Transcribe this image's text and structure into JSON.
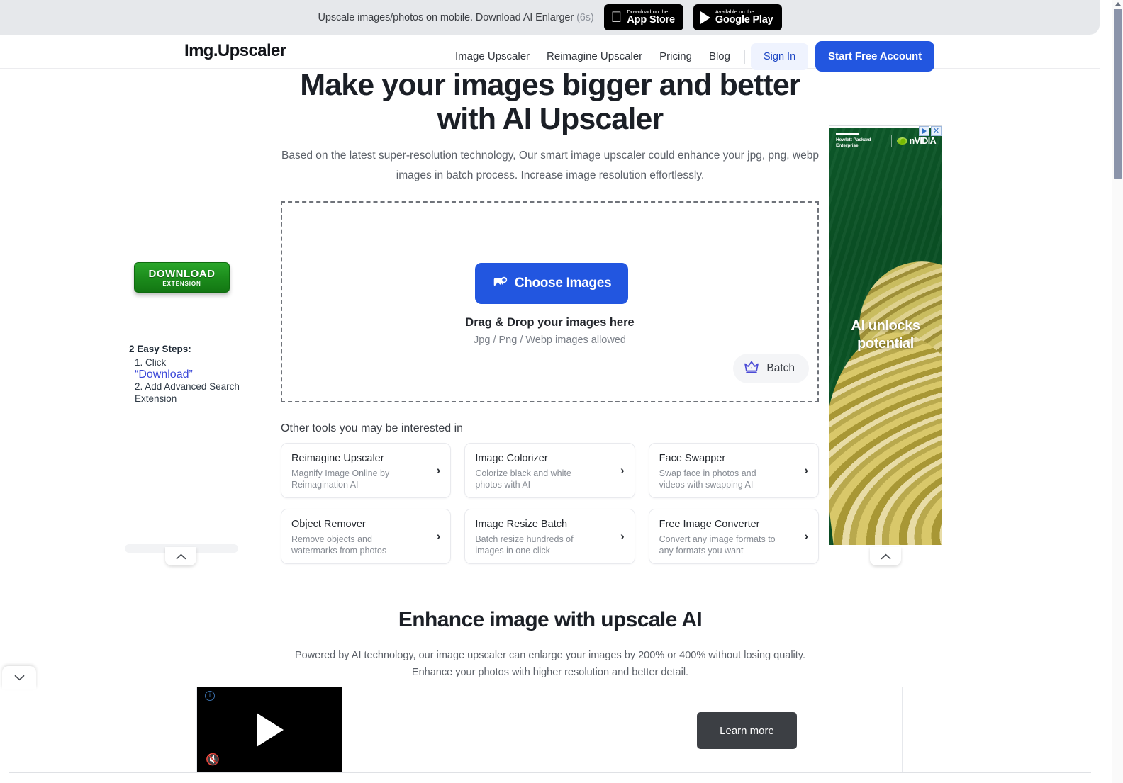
{
  "promo": {
    "text": "Upscale images/photos on mobile. Download AI Enlarger",
    "countdown": "(6s)",
    "appstore": {
      "small": "Download on the",
      "big": "App Store",
      "icon": "apple-icon"
    },
    "googleplay": {
      "small": "Available on the",
      "big": "Google Play",
      "icon": "google-play-icon"
    }
  },
  "header": {
    "logo": "Img.Upscaler",
    "nav": [
      {
        "label": "Image Upscaler"
      },
      {
        "label": "Reimagine Upscaler"
      },
      {
        "label": "Pricing"
      },
      {
        "label": "Blog"
      }
    ],
    "signin": "Sign In",
    "start": "Start Free Account",
    "accent": "#2256e0"
  },
  "hero": {
    "title": "Make your images bigger and better with AI Upscaler",
    "subtitle": "Based on the latest super-resolution technology, Our smart image upscaler could enhance your jpg, png, webp images in batch process. Increase image resolution effortlessly."
  },
  "dropzone": {
    "button": "Choose Images",
    "button_icon": "image-add-icon",
    "drag_line": "Drag & Drop your images here",
    "formats": "Jpg / Png / Webp images allowed",
    "batch": "Batch",
    "batch_icon": "crown-icon",
    "batch_icon_color": "#4b4bd6"
  },
  "tools": {
    "heading": "Other tools you may be interested in",
    "items": [
      {
        "title": "Reimagine Upscaler",
        "desc": "Magnify Image Online by Reimagination AI"
      },
      {
        "title": "Image Colorizer",
        "desc": "Colorize black and white photos with AI"
      },
      {
        "title": "Face Swapper",
        "desc": "Swap face in photos and videos with swapping AI"
      },
      {
        "title": "Object Remover",
        "desc": "Remove objects and watermarks from photos"
      },
      {
        "title": "Image Resize Batch",
        "desc": "Batch resize hundreds of images in one click"
      },
      {
        "title": "Free Image Converter",
        "desc": "Convert any image formats to any formats you want"
      }
    ],
    "chevron": "›"
  },
  "extension_ad": {
    "button_line1": "DOWNLOAD",
    "button_line2": "EXTENSION",
    "button_color": "#1c8c1c",
    "steps_heading": "2 Easy Steps:",
    "step1_prefix": "1. Click",
    "step1_link": "“Download”",
    "step2": "2. Add Advanced Search Extension",
    "link_color": "#3b48d8"
  },
  "right_ad": {
    "brand1": "Hewlett Packard Enterprise",
    "brand2": "nVIDIA",
    "headline": "AI unlocks potential",
    "adchoices_icon": "adchoices-icon",
    "close_icon": "close-icon"
  },
  "section": {
    "title": "Enhance image with upscale AI",
    "subtitle": "Powered by AI technology, our image upscaler can enlarge your images by 200% or 400% without losing quality. Enhance your photos with higher resolution and better detail."
  },
  "bottom_ad": {
    "learn_more": "Learn more",
    "play_icon": "play-icon",
    "mute_icon": "mute-icon",
    "info_icon": "ad-info-icon"
  },
  "controls": {
    "collapse_up": "⌃",
    "collapse_down": "⌄"
  }
}
